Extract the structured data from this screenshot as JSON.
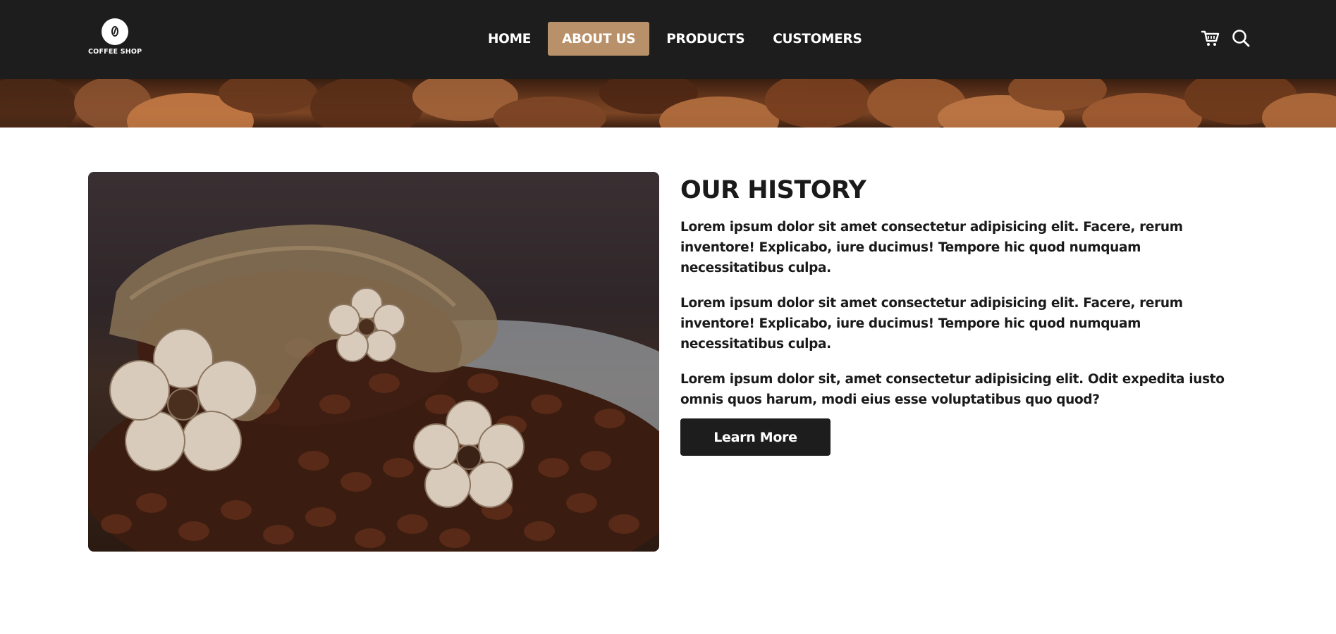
{
  "brand": {
    "logo_text": "COFFEE SHOP"
  },
  "nav": {
    "items": [
      {
        "label": "HOME",
        "active": false
      },
      {
        "label": "ABOUT US",
        "active": true
      },
      {
        "label": "PRODUCTS",
        "active": false
      },
      {
        "label": "CUSTOMERS",
        "active": false
      }
    ]
  },
  "header_icons": [
    "cart-icon",
    "search-icon"
  ],
  "about": {
    "title": "OUR HISTORY",
    "paragraphs": [
      "Lorem ipsum dolor sit amet consectetur adipisicing elit. Facere, rerum inventore! Explicabo, iure ducimus! Tempore hic quod numquam necessitatibus culpa.",
      "Lorem ipsum dolor sit amet consectetur adipisicing elit. Facere, rerum inventore! Explicabo, iure ducimus! Tempore hic quod numquam necessitatibus culpa.",
      "Lorem ipsum dolor sit, amet consectetur adipisicing elit. Odit expedita iusto omnis quos harum, modi eius esse voluptatibus quo quod?"
    ],
    "button_label": "Learn More"
  },
  "colors": {
    "header_bg": "#1d1d1d",
    "accent": "#b8916a",
    "button_bg": "#1d1d1d",
    "text": "#1a1a1a"
  }
}
